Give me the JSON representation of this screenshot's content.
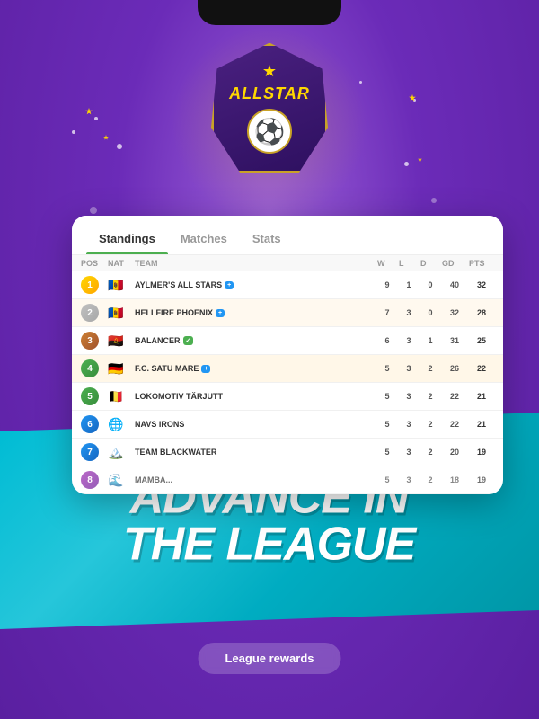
{
  "phone": {
    "notch": true
  },
  "badge": {
    "star": "★",
    "text": "ALLSTAR",
    "soccer_icon": "⚽"
  },
  "tabs": {
    "standings": "Standings",
    "matches": "Matches",
    "stats": "Stats"
  },
  "table": {
    "headers": [
      "POS",
      "NAT",
      "TEAM",
      "W",
      "L",
      "D",
      "GD",
      "PTS"
    ],
    "rows": [
      {
        "pos": 1,
        "flag": "🇲🇩",
        "team": "AYLMER'S ALL STARS",
        "w": 9,
        "l": 1,
        "d": 0,
        "gd": 40,
        "pts": 32,
        "has_badge": true
      },
      {
        "pos": 2,
        "flag": "🇲🇩",
        "team": "HELLFIRE PHOENIX",
        "w": 7,
        "l": 3,
        "d": 0,
        "gd": 32,
        "pts": 28,
        "has_badge": true
      },
      {
        "pos": 3,
        "flag": "🇦🇴",
        "team": "BALANCER",
        "w": 6,
        "l": 3,
        "d": 1,
        "gd": 31,
        "pts": 25,
        "has_badge": true
      },
      {
        "pos": 4,
        "flag": "🇩🇪",
        "team": "F.C. SATU MARE",
        "w": 5,
        "l": 3,
        "d": 2,
        "gd": 26,
        "pts": 22,
        "has_badge": true
      },
      {
        "pos": 5,
        "flag": "🇧🇪",
        "team": "LOKOMOTIV TARJUTT",
        "w": 5,
        "l": 3,
        "d": 2,
        "gd": 22,
        "pts": 21,
        "has_badge": false
      },
      {
        "pos": 6,
        "flag": "🌐",
        "team": "NAVS IRONS",
        "w": 5,
        "l": 3,
        "d": 2,
        "gd": 22,
        "pts": 21,
        "has_badge": false
      },
      {
        "pos": 7,
        "flag": "🏔️",
        "team": "TEAM BLACKWATER",
        "w": 5,
        "l": 3,
        "d": 2,
        "gd": 20,
        "pts": 19,
        "has_badge": false
      },
      {
        "pos": 8,
        "flag": "🌊",
        "team": "MAMBA...",
        "w": 5,
        "l": 3,
        "d": 2,
        "gd": 18,
        "pts": 19,
        "has_badge": false
      }
    ]
  },
  "banner": {
    "line1": "ADVANCE IN",
    "line2": "THE LEAGUE"
  },
  "rewards_button": "League rewards"
}
